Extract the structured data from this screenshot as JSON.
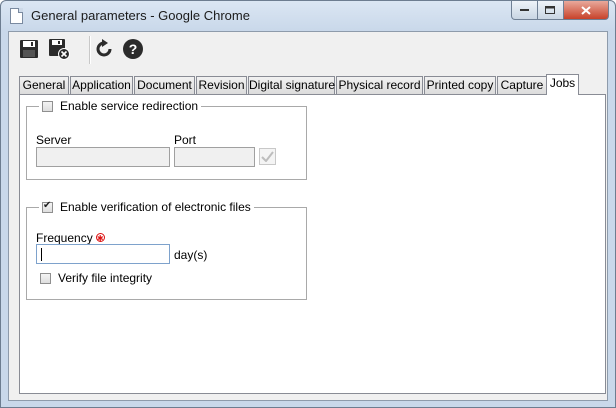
{
  "window": {
    "title": "General parameters - Google Chrome"
  },
  "toolbar": {
    "buttons": [
      {
        "name": "save",
        "icon": "floppy-disk-icon"
      },
      {
        "name": "save-and-close",
        "icon": "floppy-disk-close-icon"
      },
      {
        "name": "refresh",
        "icon": "refresh-icon"
      },
      {
        "name": "help",
        "icon": "help-icon"
      }
    ]
  },
  "tabs": [
    {
      "label": "General"
    },
    {
      "label": "Application"
    },
    {
      "label": "Document"
    },
    {
      "label": "Revision"
    },
    {
      "label": "Digital signature"
    },
    {
      "label": "Physical record"
    },
    {
      "label": "Printed copy"
    },
    {
      "label": "Capture"
    },
    {
      "label": "Jobs",
      "active": true
    }
  ],
  "service_redirection": {
    "checkbox_label": "Enable service redirection",
    "checked": false,
    "server_label": "Server",
    "server_value": "",
    "port_label": "Port",
    "port_value": ""
  },
  "verification": {
    "checkbox_label": "Enable verification of electronic files",
    "checked": true,
    "frequency_label": "Frequency",
    "frequency_value": "",
    "frequency_unit": "day(s)",
    "integrity_label": "Verify file integrity",
    "integrity_checked": false
  },
  "colors": {
    "accent": "#3a6ea5",
    "required": "#dd1111",
    "close_button": "#c7422a"
  }
}
